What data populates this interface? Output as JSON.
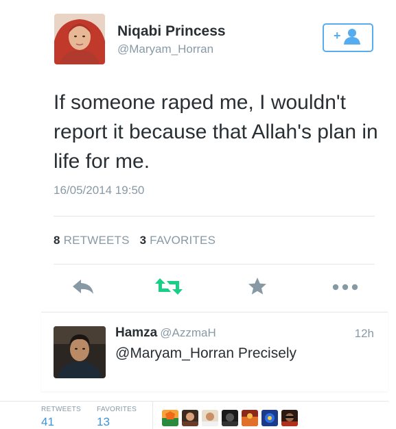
{
  "tweet": {
    "author_name": "Niqabi Princess",
    "author_handle": "@Maryam_Horran",
    "text": "If someone raped me, I wouldn't report it because that Allah's plan in life for me.",
    "timestamp": "16/05/2014 19:50",
    "retweet_count": "8",
    "retweet_label": "RETWEETS",
    "favorite_count": "3",
    "favorite_label": "FAVORITES",
    "follow_icon": "add-user-icon",
    "actions": [
      "reply-icon",
      "retweet-icon",
      "favorite-icon",
      "more-icon"
    ]
  },
  "reply": {
    "author_name": "Hamza",
    "author_handle": "@AzzmaH",
    "time": "12h",
    "text": "@Maryam_Horran Precisely"
  },
  "footer": {
    "retweets_label": "RETWEETS",
    "retweets_value": "41",
    "favorites_label": "FAVORITES",
    "favorites_value": "13"
  },
  "colors": {
    "accent_blue": "#55acee",
    "retweet_green": "#19cf86",
    "icon_gray": "#8899a6",
    "text_dark": "#292f33",
    "link_blue": "#3b94d9"
  }
}
